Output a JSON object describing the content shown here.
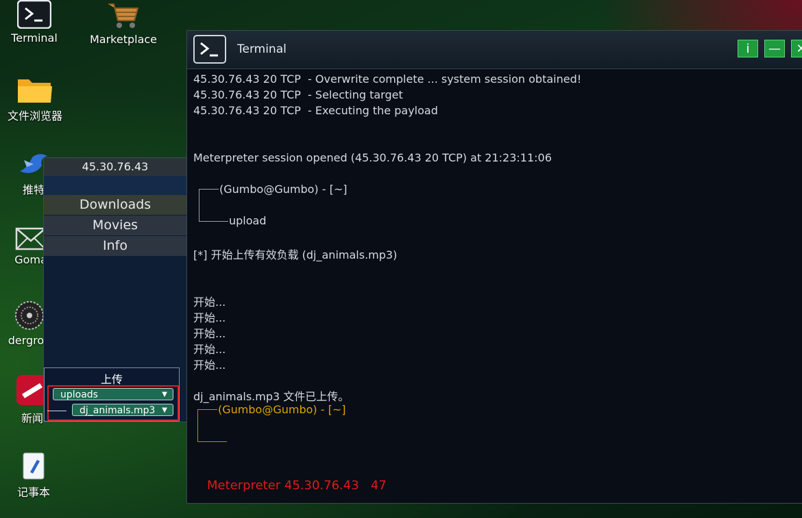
{
  "desktop": {
    "icons": [
      {
        "label": "Terminal",
        "icon": "terminal-icon"
      },
      {
        "label": "Marketplace",
        "icon": "shopping-cart-icon"
      },
      {
        "label": "文件浏览器",
        "icon": "folder-icon"
      },
      {
        "label": "推特",
        "icon": "bird-icon"
      },
      {
        "label": "Goma",
        "icon": "mail-icon"
      },
      {
        "label": "dergrou",
        "icon": "underground-icon"
      },
      {
        "label": "新闻",
        "icon": "news-icon"
      },
      {
        "label": "记事本",
        "icon": "notepad-icon"
      }
    ]
  },
  "terminal": {
    "title": "Terminal",
    "buttons": {
      "info": "i",
      "minimize": "—",
      "close": "✕"
    },
    "lines": [
      "45.30.76.43 20 TCP  - Overwrite complete ... system session obtained!",
      "45.30.76.43 20 TCP  - Selecting target",
      "45.30.76.43 20 TCP  - Executing the payload",
      "Meterpreter session opened (45.30.76.43 20 TCP) at 21:23:11:06",
      "(Gumbo@Gumbo) - [~]",
      "upload",
      "[*] 开始上传有效负载 (dj_animals.mp3)",
      "开始...",
      "开始...",
      "开始...",
      "开始...",
      "开始...",
      "dj_animals.mp3 文件已上传。",
      "(Gumbo@Gumbo) - [~]"
    ],
    "status": "Meterpreter 45.30.76.43   47"
  },
  "remote": {
    "header": "45.30.76.43",
    "menu": [
      "Downloads",
      "Movies",
      "Info"
    ],
    "upload": {
      "title": "上传",
      "folder": "uploads",
      "file": "dj_animals.mp3"
    }
  },
  "colors": {
    "accent_green": "#1e9b3e",
    "prompt_yellow": "#e0a400",
    "status_red": "#e01a1a",
    "selection_red": "#e41c1c"
  }
}
